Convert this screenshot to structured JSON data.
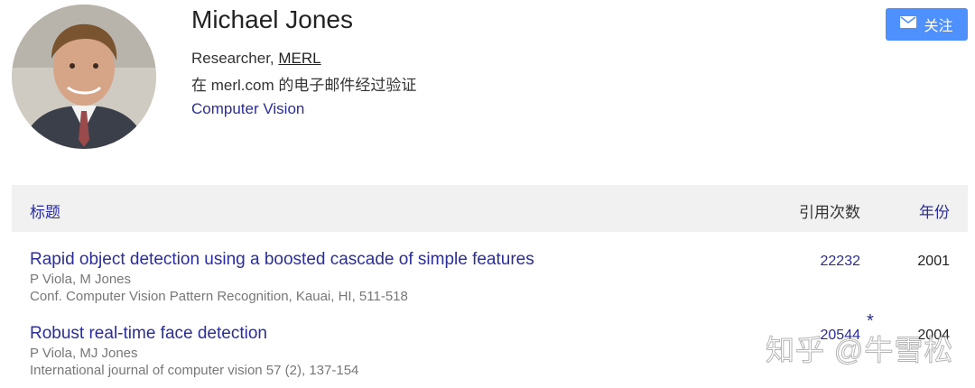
{
  "profile": {
    "name": "Michael Jones",
    "role_prefix": "Researcher, ",
    "organization": "MERL",
    "verified": "在 merl.com 的电子邮件经过验证",
    "interest": "Computer Vision"
  },
  "follow_button": {
    "label": "关注",
    "icon": "mail-icon"
  },
  "table": {
    "headers": {
      "title": "标题",
      "citations": "引用次数",
      "year": "年份"
    },
    "rows": [
      {
        "title": "Rapid object detection using a boosted cascade of simple features",
        "authors": "P Viola, M Jones",
        "venue": "Conf. Computer Vision Pattern Recognition, Kauai, HI, 511-518",
        "citations": "22232",
        "year": "2001"
      },
      {
        "title": "Robust real-time face detection",
        "authors": "P Viola, MJ Jones",
        "venue": "International journal of computer vision 57 (2), 137-154",
        "citations": "20544",
        "year": "2004",
        "marker": "*"
      }
    ]
  },
  "watermark": "知乎 @牛雪松",
  "colors": {
    "link": "#2b2d9b",
    "button": "#4d90fe",
    "header_bg": "#f1f1f1"
  }
}
